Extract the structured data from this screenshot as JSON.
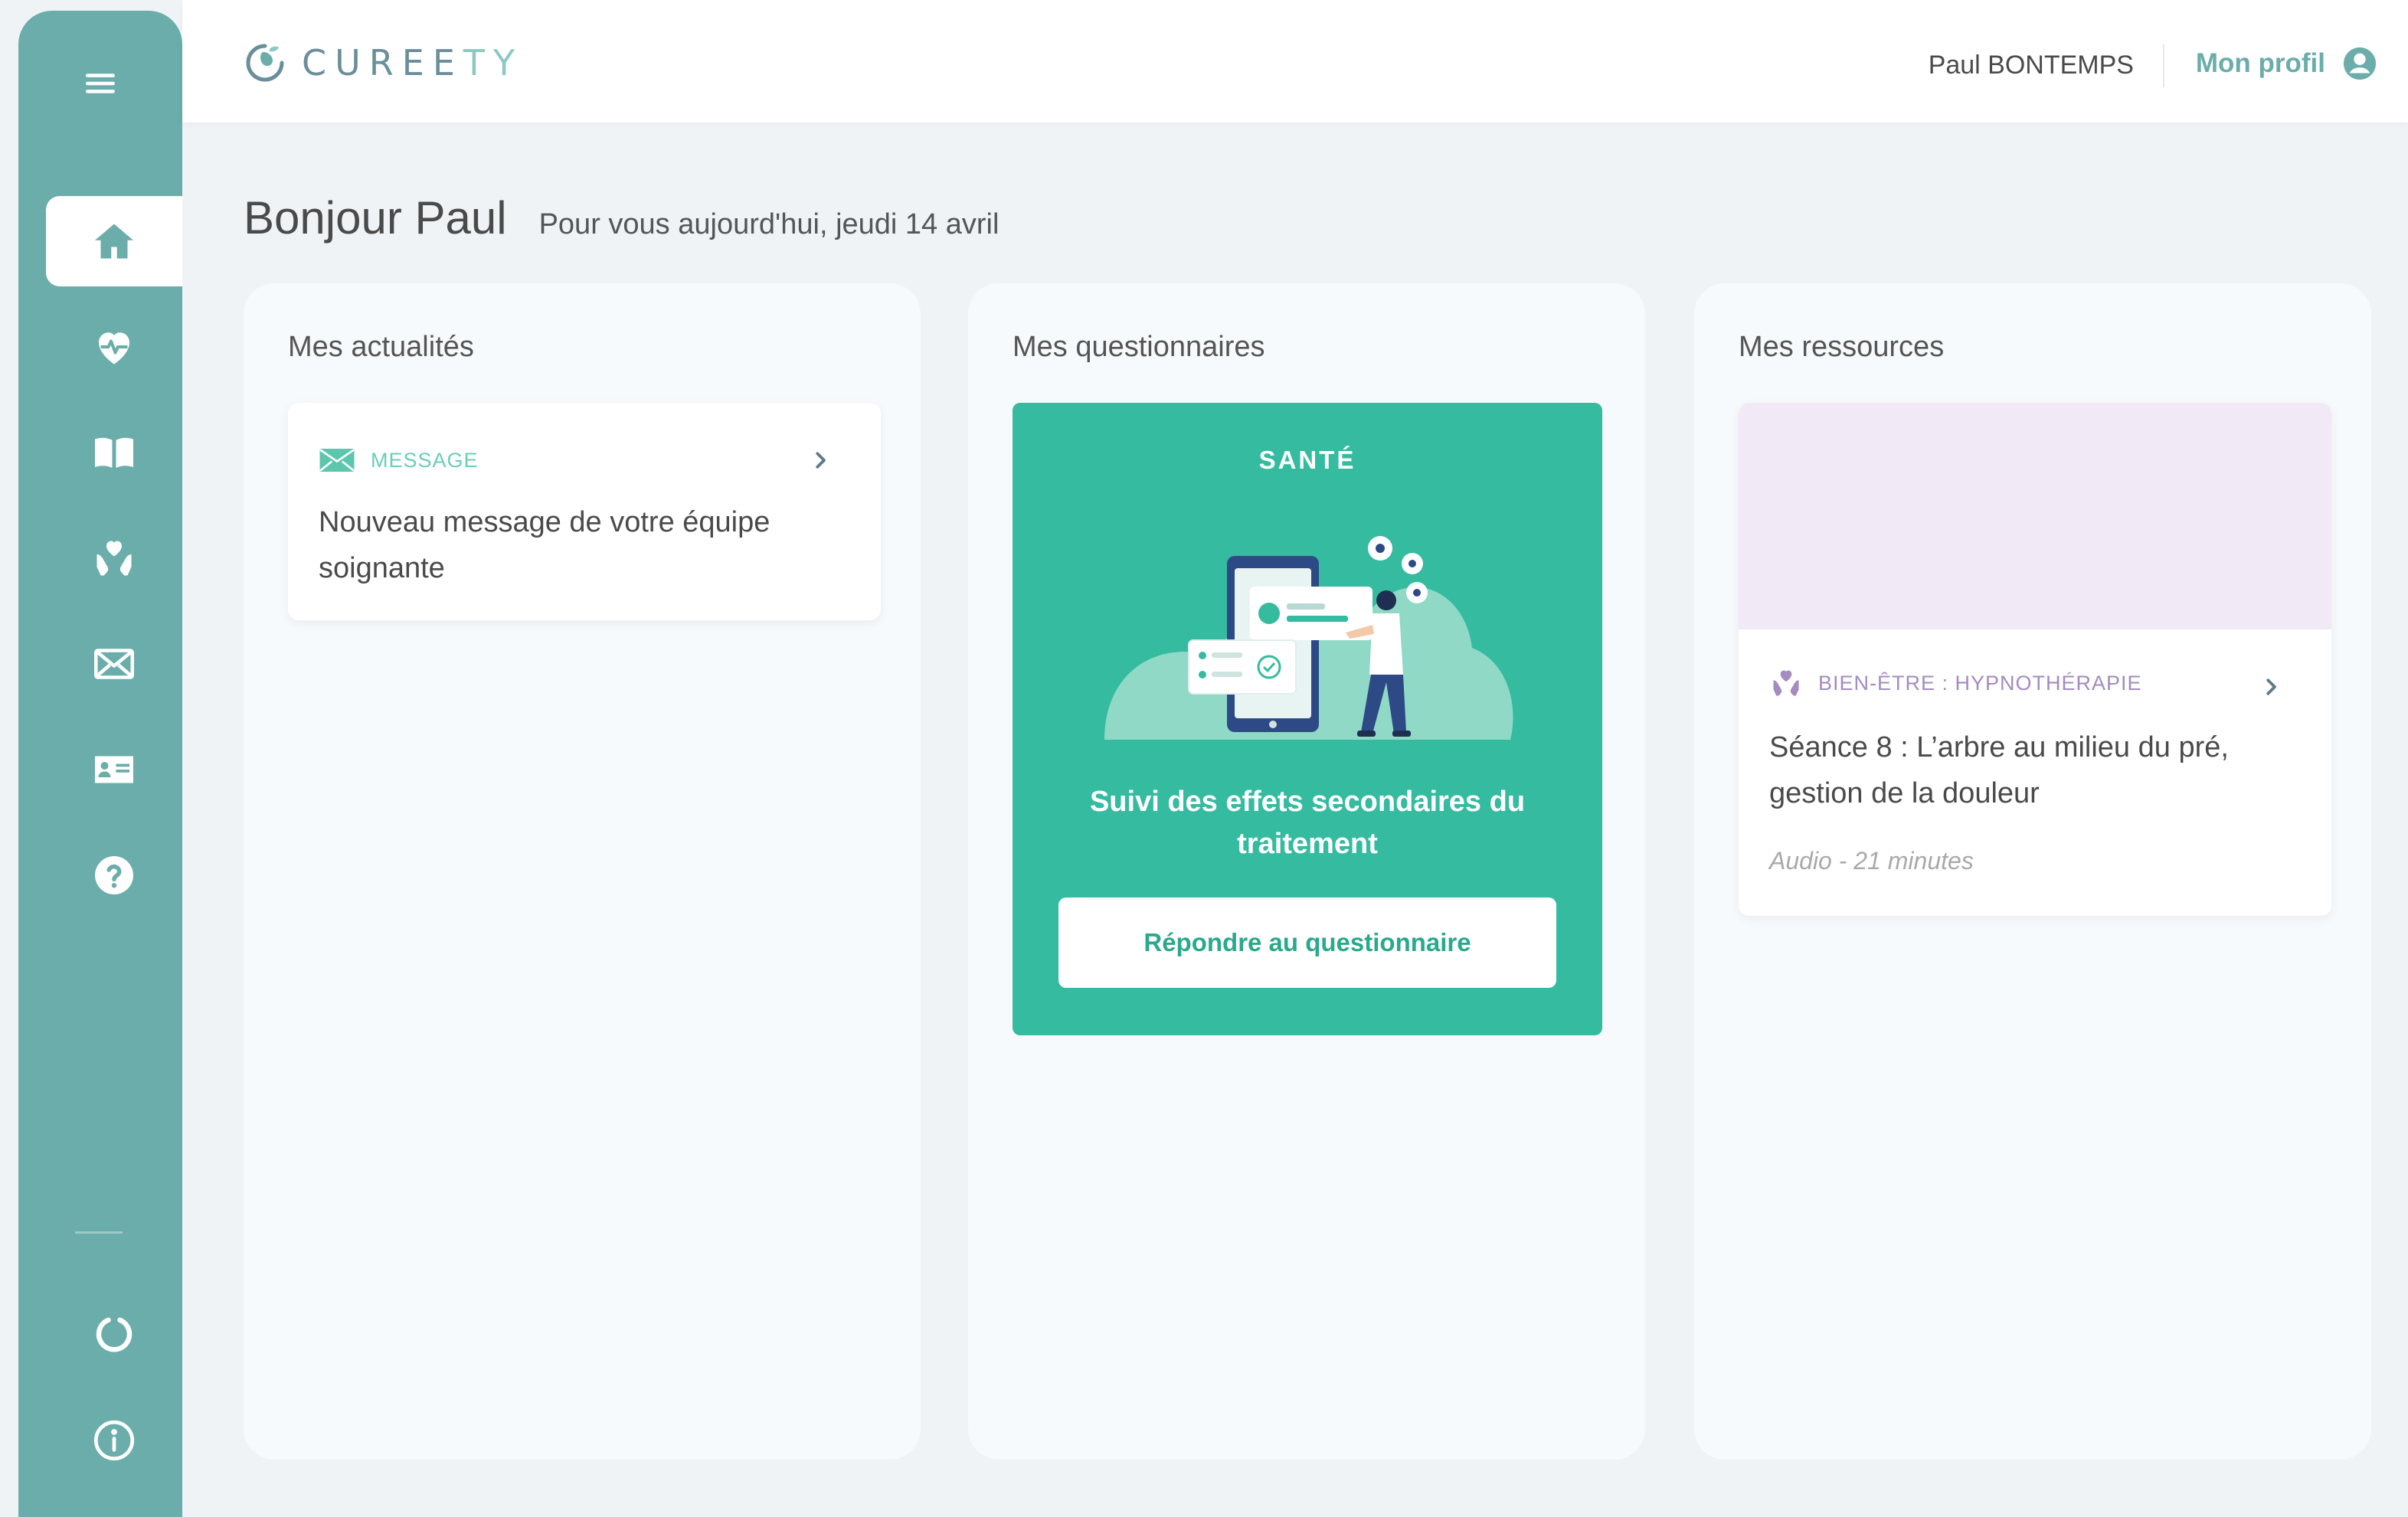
{
  "app": {
    "logo_main": "CUREE",
    "logo_tail": "TY"
  },
  "header": {
    "user_name": "Paul BONTEMPS",
    "profile_label": "Mon profil"
  },
  "greeting": {
    "title": "Bonjour Paul",
    "subtitle": "Pour vous aujourd'hui, jeudi 14 avril"
  },
  "sidebar": {
    "items": [
      {
        "icon": "home-icon",
        "active": true
      },
      {
        "icon": "heart-pulse-icon"
      },
      {
        "icon": "book-icon"
      },
      {
        "icon": "heart-hands-icon"
      },
      {
        "icon": "mail-icon"
      },
      {
        "icon": "id-card-icon"
      },
      {
        "icon": "help-icon"
      }
    ],
    "bottom_items": [
      {
        "icon": "refresh-icon"
      },
      {
        "icon": "info-icon"
      }
    ]
  },
  "columns": {
    "news": {
      "title": "Mes actualités",
      "card": {
        "tag": "MESSAGE",
        "text": "Nouveau message de votre équipe soignante"
      }
    },
    "questionnaires": {
      "title": "Mes questionnaires",
      "card": {
        "label": "SANTÉ",
        "title": "Suivi des effets secondaires du traitement",
        "button": "Répondre au questionnaire"
      }
    },
    "resources": {
      "title": "Mes ressources",
      "card": {
        "tag": "BIEN-ÊTRE : HYPNOTHÉRAPIE",
        "title": "Séance 8 : L’arbre au milieu du pré, gestion de la douleur",
        "meta": "Audio - 21 minutes"
      }
    }
  },
  "colors": {
    "sidebar": "#6aadaa",
    "accent": "#35bb9f",
    "resource_tag": "#a48bc0"
  }
}
